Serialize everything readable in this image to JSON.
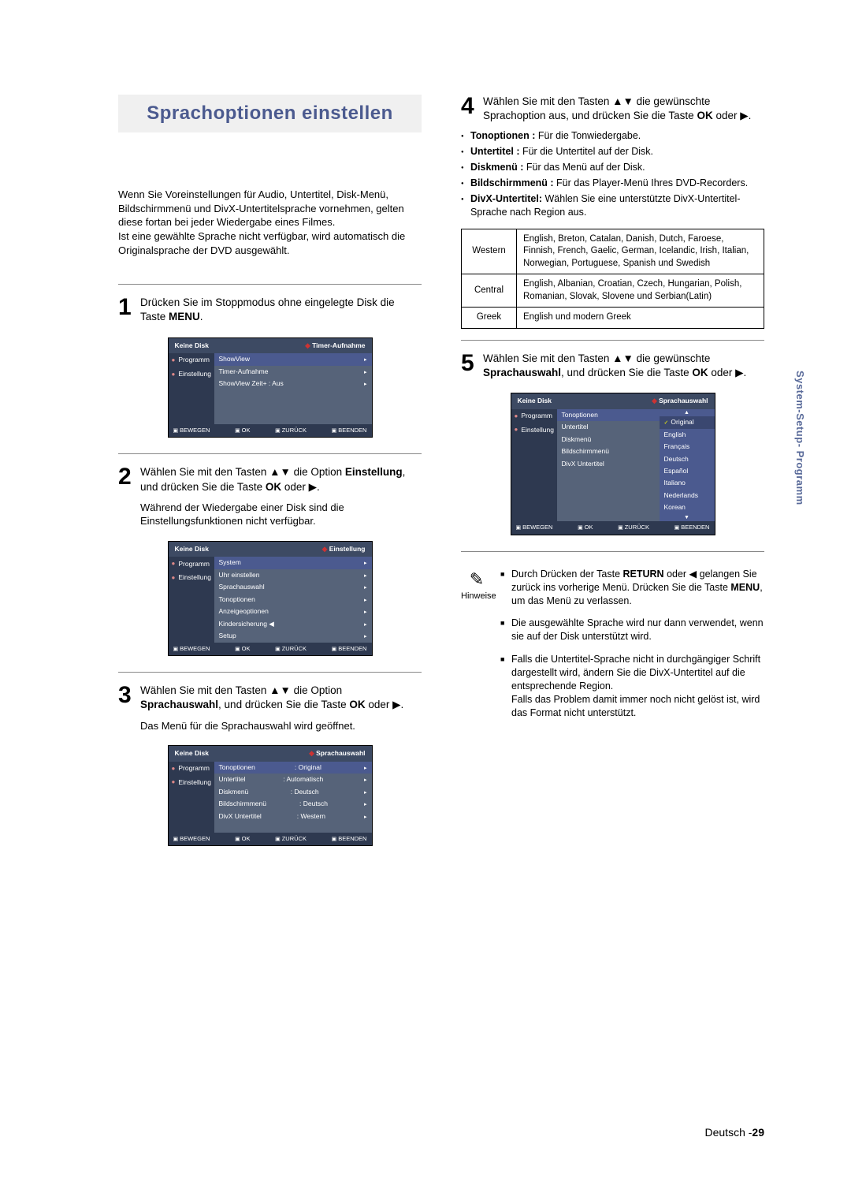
{
  "page": {
    "title": "Sprachoptionen einstellen",
    "intro": "Wenn Sie Voreinstellungen für Audio, Untertitel, Disk-Menü, Bildschirmmenü und DivX-Untertitelsprache vornehmen, gelten diese fortan bei jeder Wiedergabe eines Filmes.\nIst eine gewählte Sprache nicht verfügbar, wird automatisch die Originalsprache der DVD ausgewählt.",
    "side_tab": "System-Setup-\nProgramm",
    "footer_lang": "Deutsch -",
    "footer_page": "29"
  },
  "steps": {
    "s1": {
      "num": "1",
      "text_a": "Drücken Sie im Stoppmodus ohne eingelegte Disk die Taste ",
      "text_b": "MENU",
      "text_c": "."
    },
    "s2": {
      "num": "2",
      "text_a": "Wählen Sie mit den Tasten ▲▼ die Option ",
      "text_b": "Einstellung",
      "text_c": ", und drücken Sie die Taste ",
      "text_d": "OK",
      "text_e": " oder ▶.",
      "sub": "Während der Wiedergabe einer Disk sind die Einstellungsfunktionen nicht verfügbar."
    },
    "s3": {
      "num": "3",
      "text_a": "Wählen Sie mit den Tasten ▲▼ die Option ",
      "text_b": "Sprachauswahl",
      "text_c": ", und drücken Sie die Taste ",
      "text_d": "OK",
      "text_e": " oder ▶.",
      "sub": "Das Menü für die Sprachauswahl wird geöffnet."
    },
    "s4": {
      "num": "4",
      "text_a": "Wählen Sie mit den Tasten ▲▼ die gewünschte Sprachoption aus, und drücken Sie die Taste ",
      "text_b": "OK",
      "text_c": " oder ▶.",
      "bullets": [
        {
          "b": "Tonoptionen :",
          "t": " Für die Tonwiedergabe."
        },
        {
          "b": "Untertitel :",
          "t": " Für die Untertitel auf der Disk."
        },
        {
          "b": "Diskmenü :",
          "t": " Für das Menü auf der Disk."
        },
        {
          "b": "Bildschirmmenü :",
          "t": " Für das Player-Menü Ihres DVD-Recorders."
        },
        {
          "b": "DivX-Untertitel:",
          "t": " Wählen Sie eine unterstützte DivX-Untertitel-Sprache nach Region aus."
        }
      ]
    },
    "s5": {
      "num": "5",
      "text_a": "Wählen Sie mit den Tasten ▲▼ die gewünschte ",
      "text_b": "Sprachauswahl",
      "text_c": ", und drücken Sie die Taste ",
      "text_d": "OK",
      "text_e": " oder ▶."
    }
  },
  "regions": {
    "r1": {
      "name": "Western",
      "langs": "English, Breton, Catalan, Danish, Dutch, Faroese, Finnish, French, Gaelic, German, Icelandic, Irish, Italian, Norwegian, Portuguese, Spanish und Swedish"
    },
    "r2": {
      "name": "Central",
      "langs": "English, Albanian, Croatian, Czech, Hungarian, Polish, Romanian, Slovak, Slovene und Serbian(Latin)"
    },
    "r3": {
      "name": "Greek",
      "langs": "English und modern Greek"
    }
  },
  "notes": {
    "label": "Hinweise",
    "n1_a": "Durch Drücken der Taste ",
    "n1_b": "RETURN",
    "n1_c": " oder ◀ gelangen Sie zurück ins vorherige Menü. Drücken Sie die Taste ",
    "n1_d": "MENU",
    "n1_e": ", um das Menü zu verlassen.",
    "n2": "Die ausgewählte Sprache wird nur dann verwendet, wenn sie auf der Disk unterstützt wird.",
    "n3": "Falls die Untertitel-Sprache nicht in durchgängiger Schrift dargestellt wird, ändern Sie die DivX-Untertitel auf die entsprechende Region.\nFalls das Problem damit immer noch nicht gelöst ist, wird das Format nicht unterstützt."
  },
  "osd": {
    "no_disk": "Keine Disk",
    "side_prog": "Programm",
    "side_einst": "Einstellung",
    "foot_bewegen": "BEWEGEN",
    "foot_ok": "OK",
    "foot_zurueck": "ZURÜCK",
    "foot_beenden": "BEENDEN",
    "screen1": {
      "crumb": "Timer-Aufnahme",
      "rows": [
        "ShowView",
        "Timer-Aufnahme",
        "ShowView Zeit+ : Aus"
      ]
    },
    "screen2": {
      "crumb": "Einstellung",
      "rows": [
        "System",
        "Uhr einstellen",
        "Sprachauswahl",
        "Tonoptionen",
        "Anzeigeoptionen",
        "Kindersicherung ◀",
        "Setup"
      ]
    },
    "screen3": {
      "crumb": "Sprachauswahl",
      "rows": [
        {
          "k": "Tonoptionen",
          "v": ": Original"
        },
        {
          "k": "Untertitel",
          "v": ": Automatisch"
        },
        {
          "k": "Diskmenü",
          "v": ": Deutsch"
        },
        {
          "k": "Bildschirmmenü",
          "v": ": Deutsch"
        },
        {
          "k": "DivX Untertitel",
          "v": ": Western"
        }
      ]
    },
    "screen5": {
      "crumb": "Sprachauswahl",
      "left": [
        "Tonoptionen",
        "Untertitel",
        "Diskmenü",
        "Bildschirmmenü",
        "DivX Untertitel"
      ],
      "langs": [
        "Original",
        "English",
        "Français",
        "Deutsch",
        "Español",
        "Italiano",
        "Nederlands",
        "Korean"
      ]
    }
  }
}
